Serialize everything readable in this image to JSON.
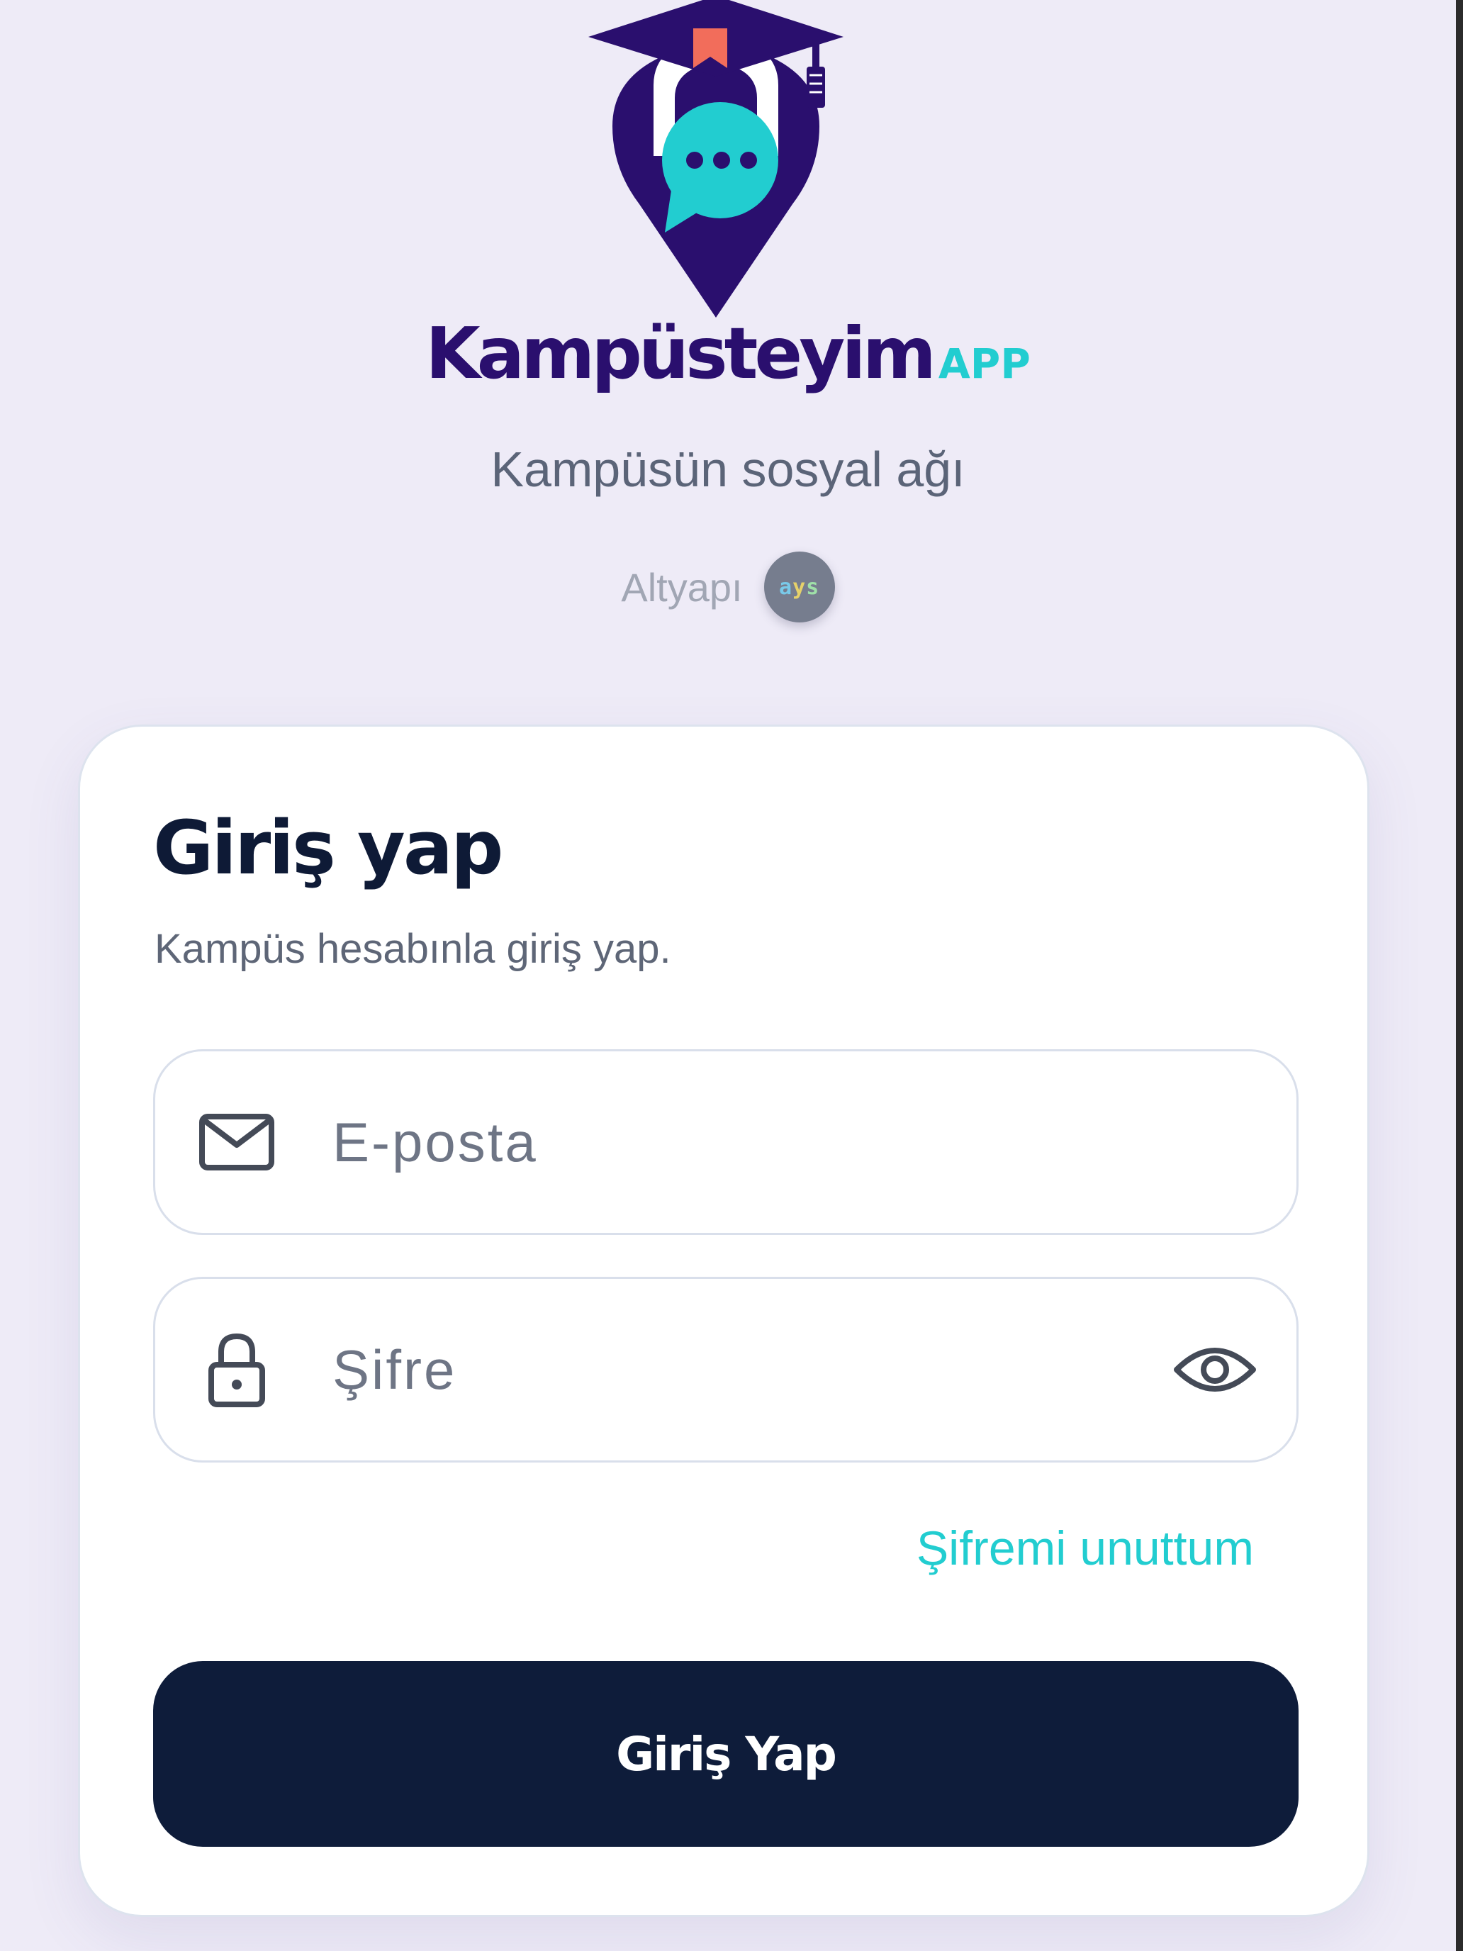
{
  "brand": {
    "name": "Kampüsteyim",
    "suffix": "APP",
    "tagline": "Kampüsün sosyal ağı",
    "powered_by_label": "Altyapı",
    "powered_by_logo": "ays",
    "colors": {
      "primary": "#2a0f6e",
      "accent": "#22cdd0",
      "bookmark": "#f26d5b"
    }
  },
  "login": {
    "title": "Giriş yap",
    "subtitle": "Kampüs hesabınla giriş yap.",
    "email": {
      "placeholder": "E-posta",
      "value": "",
      "icon": "mail-icon"
    },
    "password": {
      "placeholder": "Şifre",
      "value": "",
      "icon": "lock-icon",
      "toggle_icon": "eye-icon"
    },
    "forgot_label": "Şifremi unuttum",
    "submit_label": "Giriş Yap",
    "submit_color": "#0e1c3a"
  }
}
